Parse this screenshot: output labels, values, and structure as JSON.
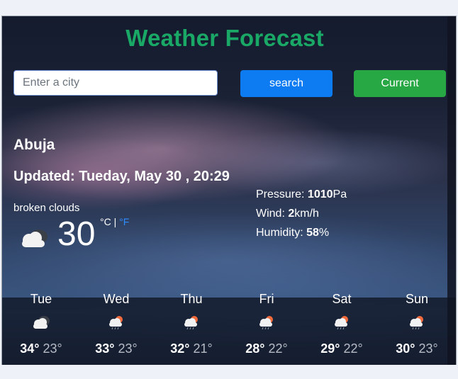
{
  "app": {
    "title": "Weather Forecast"
  },
  "search": {
    "placeholder": "Enter a city",
    "search_label": "search",
    "current_label": "Current"
  },
  "current": {
    "city": "Abuja",
    "updated": "Updated: Tueday, May 30 , 20:29",
    "description": "broken clouds",
    "temperature": "30",
    "unit_c": "°C",
    "unit_sep": " | ",
    "unit_f": "°F",
    "icon": "broken-clouds-icon",
    "pressure_label": "Pressure: ",
    "pressure_value": "1010",
    "pressure_unit": "Pa",
    "wind_label": "Wind: ",
    "wind_value": "2",
    "wind_unit": "km/h",
    "humidity_label": "Humidity: ",
    "humidity_value": "58",
    "humidity_unit": "%"
  },
  "forecast": [
    {
      "day": "Tue",
      "hi": "34°",
      "lo": "23°",
      "icon": "broken-clouds-icon"
    },
    {
      "day": "Wed",
      "hi": "33°",
      "lo": "23°",
      "icon": "light-rain-icon"
    },
    {
      "day": "Thu",
      "hi": "32°",
      "lo": "21°",
      "icon": "light-rain-icon"
    },
    {
      "day": "Fri",
      "hi": "28°",
      "lo": "22°",
      "icon": "light-rain-icon"
    },
    {
      "day": "Sat",
      "hi": "29°",
      "lo": "22°",
      "icon": "light-rain-icon"
    },
    {
      "day": "Sun",
      "hi": "30°",
      "lo": "23°",
      "icon": "light-rain-icon"
    }
  ],
  "colors": {
    "title": "#1aa866",
    "search_button": "#0d7cf2",
    "current_button": "#28a745",
    "fahrenheit_link": "#2f8cff"
  }
}
